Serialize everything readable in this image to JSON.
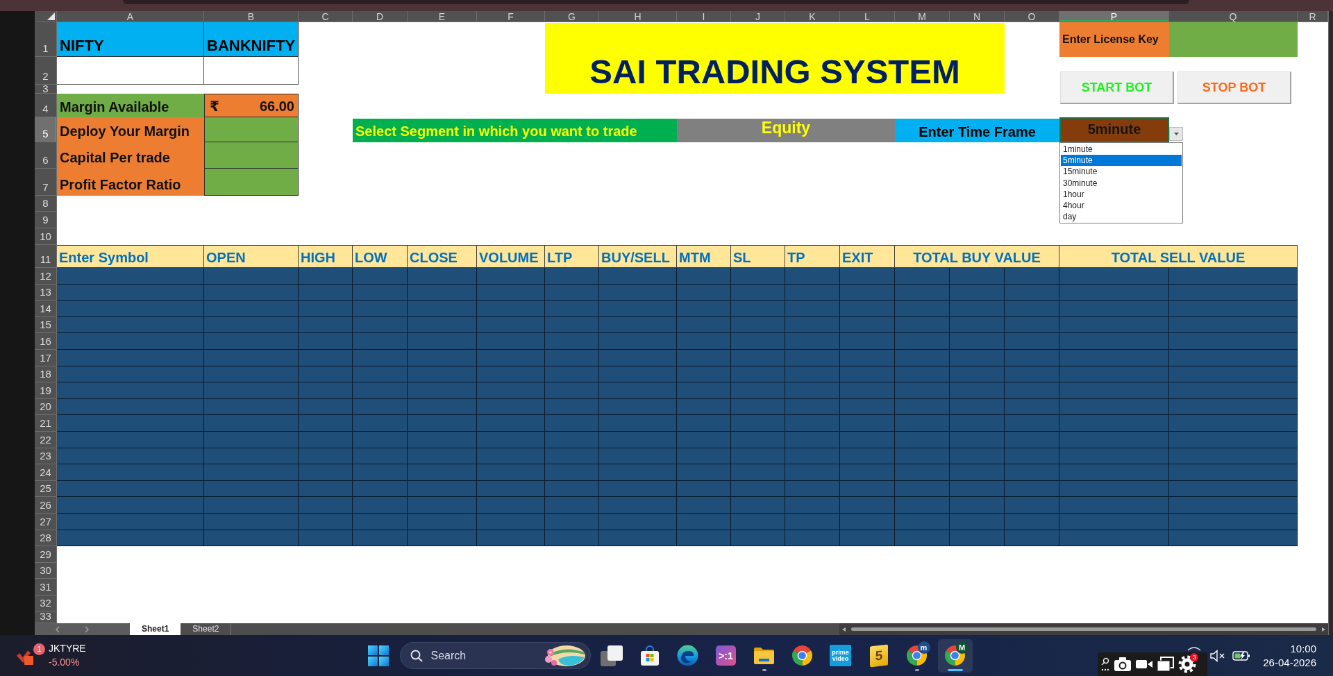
{
  "sheet": {
    "column_headers": [
      {
        "label": "A",
        "selected": false
      },
      {
        "label": "B",
        "selected": false
      },
      {
        "label": "C",
        "selected": false
      },
      {
        "label": "D",
        "selected": false
      },
      {
        "label": "E",
        "selected": false
      },
      {
        "label": "F",
        "selected": false
      },
      {
        "label": "G",
        "selected": false
      },
      {
        "label": "H",
        "selected": false
      },
      {
        "label": "I",
        "selected": false
      },
      {
        "label": "J",
        "selected": false
      },
      {
        "label": "K",
        "selected": false
      },
      {
        "label": "L",
        "selected": false
      },
      {
        "label": "M",
        "selected": false
      },
      {
        "label": "N",
        "selected": false
      },
      {
        "label": "O",
        "selected": false
      },
      {
        "label": "P",
        "selected": true
      },
      {
        "label": "Q",
        "selected": false
      },
      {
        "label": "R",
        "selected": false
      }
    ],
    "row_headers": [
      {
        "label": "1",
        "selected": false
      },
      {
        "label": "2",
        "selected": false
      },
      {
        "label": "3",
        "selected": false
      },
      {
        "label": "4",
        "selected": false
      },
      {
        "label": "5",
        "selected": true
      },
      {
        "label": "6",
        "selected": false
      },
      {
        "label": "7",
        "selected": false
      },
      {
        "label": "8",
        "selected": false
      },
      {
        "label": "9",
        "selected": false
      },
      {
        "label": "10",
        "selected": false
      },
      {
        "label": "11",
        "selected": false
      },
      {
        "label": "12",
        "selected": false
      },
      {
        "label": "13",
        "selected": false
      },
      {
        "label": "14",
        "selected": false
      },
      {
        "label": "15",
        "selected": false
      },
      {
        "label": "16",
        "selected": false
      },
      {
        "label": "17",
        "selected": false
      },
      {
        "label": "18",
        "selected": false
      },
      {
        "label": "19",
        "selected": false
      },
      {
        "label": "20",
        "selected": false
      },
      {
        "label": "21",
        "selected": false
      },
      {
        "label": "22",
        "selected": false
      },
      {
        "label": "23",
        "selected": false
      },
      {
        "label": "24",
        "selected": false
      },
      {
        "label": "25",
        "selected": false
      },
      {
        "label": "26",
        "selected": false
      },
      {
        "label": "27",
        "selected": false
      },
      {
        "label": "28",
        "selected": false
      },
      {
        "label": "29",
        "selected": false
      },
      {
        "label": "30",
        "selected": false
      },
      {
        "label": "31",
        "selected": false
      },
      {
        "label": "32",
        "selected": false
      },
      {
        "label": "33",
        "selected": false
      }
    ],
    "indices": [
      {
        "label": "NIFTY"
      },
      {
        "label": "BANKNIFTY"
      }
    ],
    "title": "SAI TRADING SYSTEM",
    "license": {
      "label": "Enter License Key"
    },
    "bot_buttons": [
      {
        "label": "START BOT",
        "color": "#1ef21e"
      },
      {
        "label": "STOP BOT",
        "color": "#fd6b1a"
      }
    ],
    "margin": {
      "label": "Margin Available",
      "currency": "₹",
      "value": "66.00"
    },
    "settings": [
      {
        "label": "Deploy Your Margin"
      },
      {
        "label": "Capital Per trade"
      },
      {
        "label": "Profit Factor Ratio"
      }
    ],
    "segment": {
      "label": "Select Segment in which you want to trade",
      "value": "Equity"
    },
    "time_frame": {
      "label": "Enter Time Frame",
      "value": "5minute",
      "selected": true,
      "expanded": true,
      "options": [
        {
          "label": "1minute",
          "selected": false
        },
        {
          "label": "5minute",
          "selected": true
        },
        {
          "label": "15minute",
          "selected": false
        },
        {
          "label": "30minute",
          "selected": false
        },
        {
          "label": "1hour",
          "selected": false
        },
        {
          "label": "4hour",
          "selected": false
        },
        {
          "label": "day",
          "selected": false
        }
      ]
    },
    "table": {
      "columns": [
        {
          "label": "Enter Symbol"
        },
        {
          "label": "OPEN"
        },
        {
          "label": "HIGH"
        },
        {
          "label": "LOW"
        },
        {
          "label": "CLOSE"
        },
        {
          "label": "VOLUME"
        },
        {
          "label": "LTP"
        },
        {
          "label": "BUY/SELL"
        },
        {
          "label": "MTM"
        },
        {
          "label": "SL"
        },
        {
          "label": "TP"
        },
        {
          "label": "EXIT"
        },
        {
          "label": "TOTAL BUY VALUE"
        },
        {
          "label": "TOTAL SELL VALUE"
        }
      ]
    }
  },
  "sheet_tabs": [
    {
      "label": "Sheet1",
      "selected": true
    },
    {
      "label": "Sheet2",
      "selected": false
    }
  ],
  "taskbar": {
    "stock": {
      "symbol": "JKTYRE",
      "change": "-5.00%",
      "badge": "1"
    },
    "search": {
      "placeholder": "Search"
    },
    "apps": [
      {
        "kind": "taskview",
        "running": false,
        "active": false
      },
      {
        "kind": "store",
        "running": false,
        "active": false
      },
      {
        "kind": "swirl",
        "running": false,
        "active": false
      },
      {
        "kind": "console",
        "label": ">:1",
        "running": false,
        "active": false
      },
      {
        "kind": "folder",
        "running": true,
        "active": false
      },
      {
        "kind": "browser",
        "running": false,
        "active": false
      },
      {
        "kind": "video",
        "label": "prime video",
        "running": false,
        "active": false
      },
      {
        "kind": "book",
        "label": "5",
        "running": false,
        "active": false
      },
      {
        "kind": "browser",
        "badge": {
          "label": "m",
          "color": "#1d4f8c"
        },
        "running": true,
        "active": false
      },
      {
        "kind": "browser",
        "badge": {
          "label": "M",
          "color": "#0e5234"
        },
        "running": true,
        "active": true
      }
    ],
    "tray": {
      "settings_badge": "3"
    },
    "clock": {
      "time": "10:00",
      "date": "26-04-2026"
    }
  }
}
